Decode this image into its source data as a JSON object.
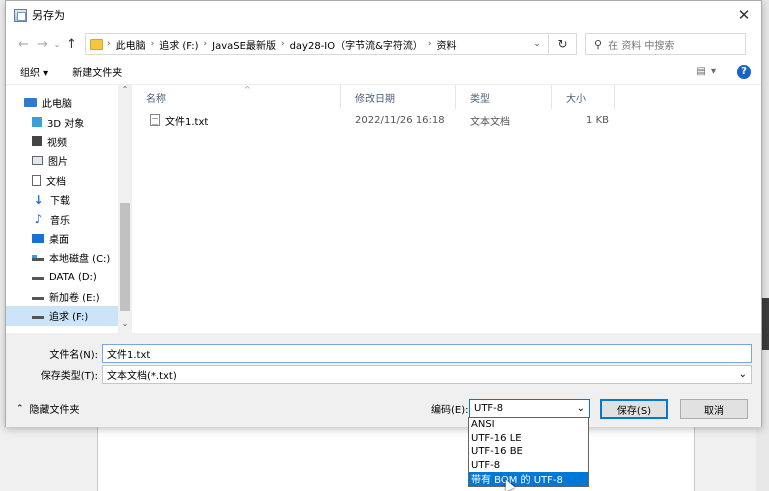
{
  "title": "另存为",
  "nav": {
    "back": "←",
    "forward": "→",
    "up": "↑",
    "breadcrumbs": [
      "此电脑",
      "追求 (F:)",
      "JavaSE最新版",
      "day28-IO（字节流&字符流）",
      "资料"
    ],
    "refresh": "↻",
    "search_placeholder": "在 资料 中搜索"
  },
  "toolbar": {
    "organize": "组织 ▾",
    "new_folder": "新建文件夹",
    "view_icon": "view-options-icon",
    "help": "?"
  },
  "sidebar": {
    "items": [
      {
        "label": "此电脑",
        "icon": "computer-icon"
      },
      {
        "label": "3D 对象",
        "icon": "cube-icon"
      },
      {
        "label": "视频",
        "icon": "video-icon"
      },
      {
        "label": "图片",
        "icon": "picture-icon"
      },
      {
        "label": "文档",
        "icon": "document-icon"
      },
      {
        "label": "下载",
        "icon": "download-icon"
      },
      {
        "label": "音乐",
        "icon": "music-icon"
      },
      {
        "label": "桌面",
        "icon": "desktop-icon"
      },
      {
        "label": "本地磁盘 (C:)",
        "icon": "drive-icon"
      },
      {
        "label": "DATA (D:)",
        "icon": "drive-icon"
      },
      {
        "label": "新加卷 (E:)",
        "icon": "drive-icon"
      },
      {
        "label": "追求 (F:)",
        "icon": "drive-icon",
        "selected": true
      }
    ]
  },
  "columns": {
    "name": "名称",
    "modified": "修改日期",
    "type": "类型",
    "size": "大小"
  },
  "files": [
    {
      "name": "文件1.txt",
      "modified": "2022/11/26 16:18",
      "type": "文本文档",
      "size": "1 KB"
    }
  ],
  "form": {
    "filename_label": "文件名(N):",
    "filename_value": "文件1.txt",
    "filetype_label": "保存类型(T):",
    "filetype_value": "文本文档(*.txt)",
    "hide_folders": "隐藏文件夹",
    "encoding_label": "编码(E):",
    "encoding_value": "UTF-8",
    "save": "保存(S)",
    "cancel": "取消"
  },
  "encoding_options": [
    "ANSI",
    "UTF-16 LE",
    "UTF-16 BE",
    "UTF-8",
    "带有 BOM 的 UTF-8"
  ],
  "encoding_highlighted": "带有 BOM 的 UTF-8",
  "colors": {
    "accent": "#0078d7",
    "selection": "#cce4f7",
    "header_text": "#4c607a"
  }
}
